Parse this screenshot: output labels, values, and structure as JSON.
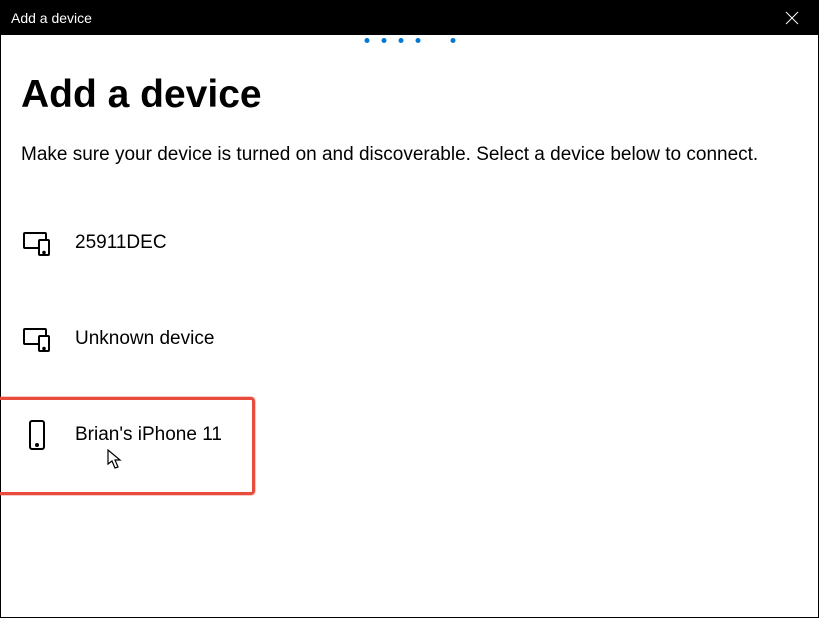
{
  "titlebar": {
    "title": "Add a device"
  },
  "dialog": {
    "heading": "Add a device",
    "description": "Make sure your device is turned on and discoverable. Select a device below to connect."
  },
  "devices": [
    {
      "name": "25911DEC",
      "icon": "multi-device"
    },
    {
      "name": "Unknown device",
      "icon": "multi-device"
    },
    {
      "name": "Brian's iPhone 11",
      "icon": "phone"
    }
  ]
}
